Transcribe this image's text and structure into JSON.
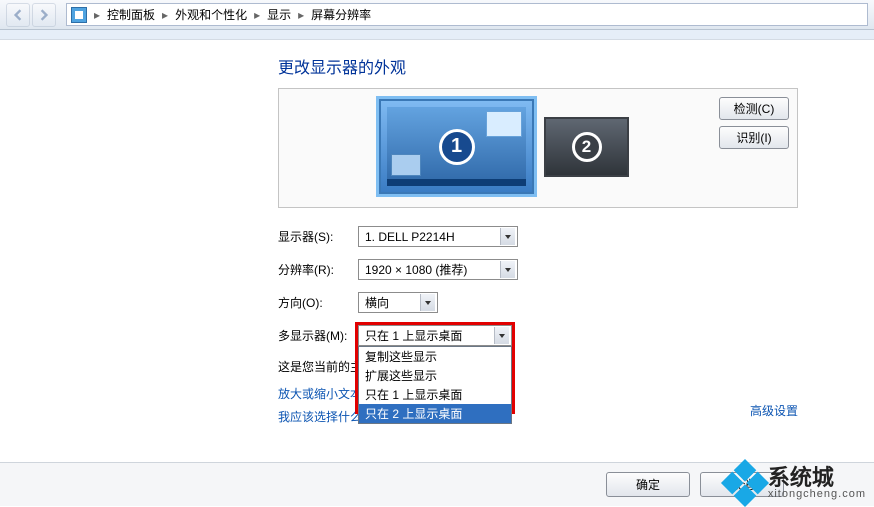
{
  "breadcrumb": {
    "items": [
      "控制面板",
      "外观和个性化",
      "显示",
      "屏幕分辨率"
    ]
  },
  "page": {
    "title": "更改显示器的外观"
  },
  "preview": {
    "detect_btn": "检测(C)",
    "identify_btn": "识别(I)",
    "monitors": [
      {
        "num": "1"
      },
      {
        "num": "2"
      }
    ]
  },
  "form": {
    "display_label": "显示器(S):",
    "display_value": "1. DELL P2214H",
    "resolution_label": "分辨率(R):",
    "resolution_value": "1920 × 1080 (推荐)",
    "orientation_label": "方向(O):",
    "orientation_value": "横向",
    "multi_label": "多显示器(M):",
    "multi_value": "只在 1 上显示桌面",
    "multi_options": [
      "复制这些显示",
      "扩展这些显示",
      "只在 1 上显示桌面",
      "只在 2 上显示桌面"
    ],
    "multi_selected_index": 3
  },
  "notes": {
    "current_main": "这是您当前的主",
    "text_size_link": "放大或缩小文本",
    "which_display_link": "我应该选择什么显示器设置？",
    "advanced_link": "高级设置"
  },
  "footer": {
    "ok": "确定",
    "cancel": "取消"
  },
  "watermark": {
    "title": "系统城",
    "url": "xitongcheng.com"
  }
}
